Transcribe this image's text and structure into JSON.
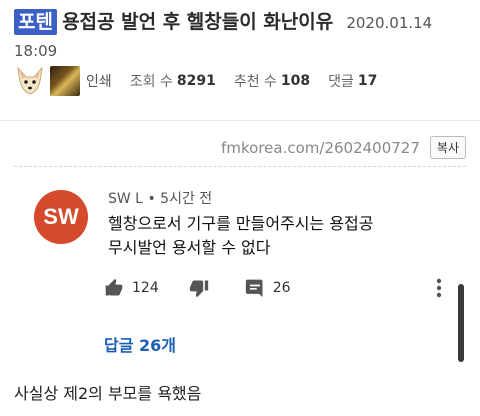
{
  "post": {
    "category": "포텐",
    "title": "용접공 발언 후 헬창들이 화난이유",
    "date": "2020.01.14 18:09"
  },
  "meta": {
    "print_label": "인쇄",
    "views_label": "조회 수",
    "views_value": "8291",
    "recommend_label": "추천 수",
    "recommend_value": "108",
    "comments_label": "댓글",
    "comments_value": "17"
  },
  "source": {
    "url": "fmkorea.com/2602400727",
    "copy_label": "복사"
  },
  "comment": {
    "avatar_initials": "SW",
    "author": "SW L",
    "separator": "•",
    "time": "5시간 전",
    "text_line1": "헬창으로서 기구를 만들어주시는 용접공",
    "text_line2": "무시발언 용서할 수 없다",
    "like_count": "124",
    "reply_count": "26",
    "avatar_color": "#d44a2a"
  },
  "replies": {
    "label": "답글 26개",
    "color": "#1a5fb4"
  },
  "body_text": "사실상 제2의 부모를 욕했음",
  "accent_colors": {
    "category_bg": "#3b5fc4"
  },
  "icons": [
    "dog-avatar",
    "art-avatar",
    "thumbs-up-icon",
    "thumbs-down-icon",
    "comment-icon",
    "more-vert-icon"
  ]
}
